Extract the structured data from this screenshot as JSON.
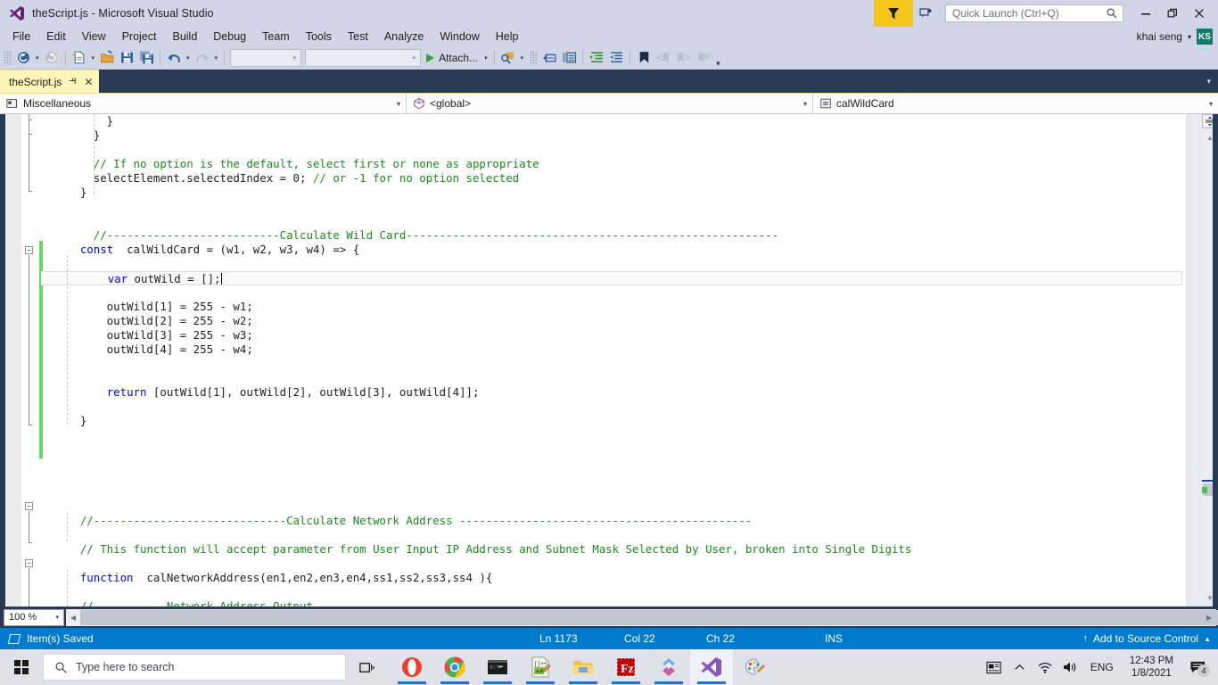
{
  "window": {
    "title": "theScript.js - Microsoft Visual Studio",
    "logo_icon": "visual-studio-logo-icon",
    "minimize_glyph": "–",
    "maximize_glyph": "❐",
    "close_glyph": "✕"
  },
  "titlebar_right": {
    "filter_icon": "filter-funnel-icon",
    "feedback_icon": "send-feedback-icon",
    "quick_launch_placeholder": "Quick Launch (Ctrl+Q)",
    "search_icon": "search-magnifier-icon"
  },
  "menu": {
    "items": [
      {
        "label": "File"
      },
      {
        "label": "Edit"
      },
      {
        "label": "View"
      },
      {
        "label": "Project"
      },
      {
        "label": "Build"
      },
      {
        "label": "Debug"
      },
      {
        "label": "Team"
      },
      {
        "label": "Tools"
      },
      {
        "label": "Test"
      },
      {
        "label": "Analyze"
      },
      {
        "label": "Window"
      },
      {
        "label": "Help"
      }
    ],
    "user_name": "khai seng",
    "user_caret": "▾",
    "avatar_initials": "KS"
  },
  "toolbar": {
    "navigate_back_icon": "navigate-backward-icon",
    "navigate_forward_icon": "navigate-forward-icon",
    "new_item_icon": "new-file-icon",
    "open_file_icon": "open-file-icon",
    "save_icon": "save-icon",
    "save_all_icon": "save-all-icon",
    "undo_icon": "undo-icon",
    "redo_icon": "redo-icon",
    "combo1_value": "",
    "combo2_value": "",
    "attach_label": "Attach...",
    "attach_caret": "▾",
    "find_icon": "find-in-files-icon",
    "comment_icon": "comment-selection-icon",
    "uncomment_icon": "uncomment-selection-icon",
    "indent_icon": "increase-indent-icon",
    "outdent_icon": "decrease-indent-icon",
    "bookmark_icon": "toggle-bookmark-icon",
    "prev_bookmark_icon": "previous-bookmark-icon",
    "next_bookmark_icon": "next-bookmark-icon",
    "clear_bookmarks_icon": "clear-bookmarks-icon",
    "overflow_glyph": "≡"
  },
  "tabs": {
    "active": {
      "label": "theScript.js",
      "pin_glyph": "⚐",
      "close_glyph": "✕"
    },
    "overflow_caret": "▾"
  },
  "navbar": {
    "project_icon": "project-miscellaneous-icon",
    "project": "Miscellaneous",
    "type_icon": "globe-namespace-icon",
    "type": "<global>",
    "member_icon": "method-member-icon",
    "member": "calWildCard",
    "caret": "▾"
  },
  "editor": {
    "lines": [
      {
        "indent": 8,
        "segs": [
          {
            "t": "}",
            "c": "plain"
          }
        ]
      },
      {
        "indent": 6,
        "segs": [
          {
            "t": "}",
            "c": "plain"
          }
        ]
      },
      {
        "indent": 0,
        "segs": []
      },
      {
        "indent": 6,
        "segs": [
          {
            "t": "// If no option is the default, select first or none as appropriate",
            "c": "cm"
          }
        ]
      },
      {
        "indent": 6,
        "segs": [
          {
            "t": "selectElement.selectedIndex = 0; ",
            "c": "plain"
          },
          {
            "t": "// or -1 for no option selected",
            "c": "cm"
          }
        ]
      },
      {
        "indent": 4,
        "segs": [
          {
            "t": "}",
            "c": "plain"
          }
        ]
      },
      {
        "indent": 0,
        "segs": []
      },
      {
        "indent": 0,
        "segs": []
      },
      {
        "indent": 6,
        "segs": [
          {
            "t": "//--------------------------Calculate Wild Card--------------------------------------------------------",
            "c": "cm"
          }
        ]
      },
      {
        "indent": 4,
        "segs": [
          {
            "t": "const",
            "c": "kw"
          },
          {
            "t": "  calWildCard = (w1, w2, w3, w4) => {",
            "c": "plain"
          }
        ]
      },
      {
        "indent": 0,
        "segs": []
      },
      {
        "indent": 8,
        "current": true,
        "segs": [
          {
            "t": "var",
            "c": "kw"
          },
          {
            "t": " outWild = [];",
            "c": "plain"
          }
        ]
      },
      {
        "indent": 0,
        "segs": []
      },
      {
        "indent": 8,
        "segs": [
          {
            "t": "outWild[1] = 255 - w1;",
            "c": "plain"
          }
        ]
      },
      {
        "indent": 8,
        "segs": [
          {
            "t": "outWild[2] = 255 - w2;",
            "c": "plain"
          }
        ]
      },
      {
        "indent": 8,
        "segs": [
          {
            "t": "outWild[3] = 255 - w3;",
            "c": "plain"
          }
        ]
      },
      {
        "indent": 8,
        "segs": [
          {
            "t": "outWild[4] = 255 - w4;",
            "c": "plain"
          }
        ]
      },
      {
        "indent": 0,
        "segs": []
      },
      {
        "indent": 0,
        "segs": []
      },
      {
        "indent": 8,
        "segs": [
          {
            "t": "return",
            "c": "kw"
          },
          {
            "t": " [outWild[1], outWild[2], outWild[3], outWild[4]];",
            "c": "plain"
          }
        ]
      },
      {
        "indent": 0,
        "segs": []
      },
      {
        "indent": 4,
        "segs": [
          {
            "t": "}",
            "c": "plain"
          }
        ]
      },
      {
        "indent": 0,
        "segs": []
      },
      {
        "indent": 0,
        "segs": []
      },
      {
        "indent": 0,
        "segs": []
      },
      {
        "indent": 0,
        "segs": []
      },
      {
        "indent": 0,
        "segs": []
      },
      {
        "indent": 0,
        "segs": []
      },
      {
        "indent": 4,
        "segs": [
          {
            "t": "//-----------------------------Calculate Network Address --------------------------------------------",
            "c": "cm"
          }
        ]
      },
      {
        "indent": 0,
        "segs": []
      },
      {
        "indent": 4,
        "segs": [
          {
            "t": "// This function will accept parameter from User Input IP Address and Subnet Mask Selected by User, broken into Single Digits",
            "c": "cm"
          }
        ]
      },
      {
        "indent": 0,
        "segs": []
      },
      {
        "indent": 4,
        "segs": [
          {
            "t": "function",
            "c": "kw"
          },
          {
            "t": "  calNetworkAddress(en1,en2,en3,en4,ss1,ss2,ss3,ss4 ){",
            "c": "plain"
          }
        ]
      },
      {
        "indent": 0,
        "segs": []
      },
      {
        "indent": 4,
        "segs": [
          {
            "t": "//-----------Network Address Output -------------------------------------",
            "c": "cm"
          }
        ]
      }
    ],
    "zoom_level": "100 %",
    "zoom_caret": "▾",
    "split_view_icon": "split-view-icon",
    "scroll_up_glyph": "▲",
    "scroll_down_glyph": "▼",
    "scroll_left_glyph": "◀",
    "scroll_right_glyph": "▶"
  },
  "statusbar": {
    "save_icon": "item-saved-icon",
    "message": "Item(s) Saved",
    "line": "Ln 1173",
    "column": "Col 22",
    "character": "Ch 22",
    "insert_mode": "INS",
    "source_control": "Add to Source Control",
    "source_control_icon": "upload-arrow-icon",
    "source_control_caret": "▲"
  },
  "taskbar": {
    "start_icon": "windows-start-icon",
    "search_placeholder": "Type here to search",
    "search_icon": "search-magnifier-icon",
    "task_view_icon": "task-view-icon",
    "apps": [
      {
        "name": "opera-browser-icon",
        "active": false
      },
      {
        "name": "google-chrome-icon",
        "active": false
      },
      {
        "name": "command-prompt-icon",
        "active": false
      },
      {
        "name": "notepad-plus-plus-icon",
        "active": false
      },
      {
        "name": "file-explorer-icon",
        "active": false
      },
      {
        "name": "filezilla-icon",
        "active": false
      },
      {
        "name": "visual-studio-installer-icon",
        "active": false
      },
      {
        "name": "visual-studio-icon",
        "active": true
      },
      {
        "name": "paint-icon",
        "active": false
      }
    ],
    "tray": {
      "news_icon": "news-and-interests-icon",
      "show_hidden_icon": "show-hidden-icons-chevron",
      "network_icon": "wifi-icon",
      "volume_icon": "speaker-volume-icon",
      "language": "ENG",
      "time": "12:43 PM",
      "date": "1/8/2021",
      "notification_icon": "action-center-icon",
      "notification_count": "4"
    }
  }
}
